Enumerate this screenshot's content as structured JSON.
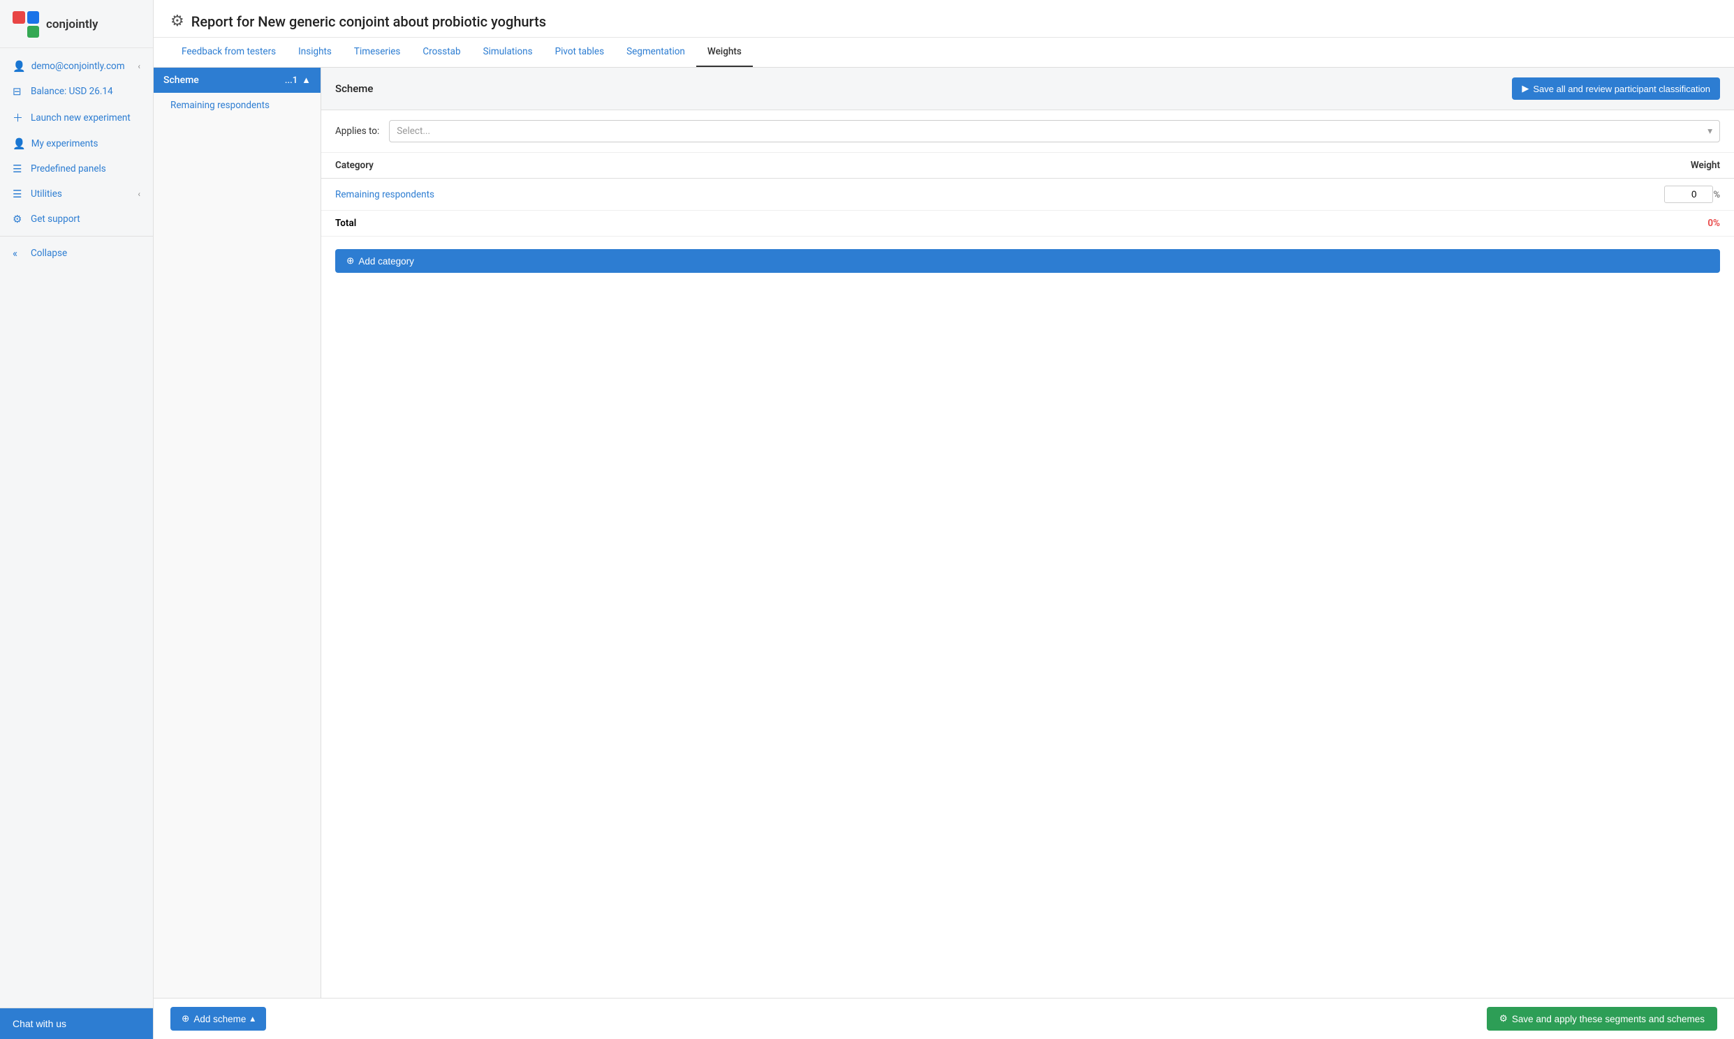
{
  "app": {
    "logo_text": "conjointly"
  },
  "sidebar": {
    "user_email": "demo@conjointly.com",
    "balance": "Balance: USD 26.14",
    "launch": "Launch new experiment",
    "my_experiments": "My experiments",
    "predefined_panels": "Predefined panels",
    "utilities": "Utilities",
    "get_support": "Get support",
    "collapse": "Collapse",
    "chat_label": "Chat with us"
  },
  "header": {
    "icon": "⚙",
    "title": "Report for New generic conjoint about probiotic yoghurts"
  },
  "tabs": [
    {
      "id": "feedback",
      "label": "Feedback from testers",
      "active": false
    },
    {
      "id": "insights",
      "label": "Insights",
      "active": false
    },
    {
      "id": "timeseries",
      "label": "Timeseries",
      "active": false
    },
    {
      "id": "crosstab",
      "label": "Crosstab",
      "active": false
    },
    {
      "id": "simulations",
      "label": "Simulations",
      "active": false
    },
    {
      "id": "pivot",
      "label": "Pivot tables",
      "active": false
    },
    {
      "id": "segmentation",
      "label": "Segmentation",
      "active": false
    },
    {
      "id": "weights",
      "label": "Weights",
      "active": true
    }
  ],
  "scheme_panel": {
    "scheme_label": "Scheme",
    "scheme_number": "...1",
    "sub_item": "Remaining respondents"
  },
  "scheme_detail": {
    "title": "Scheme",
    "save_classify_label": "Save all and review participant classification",
    "applies_label": "Applies to:",
    "applies_placeholder": "Select...",
    "table": {
      "col_category": "Category",
      "col_weight": "Weight",
      "rows": [
        {
          "category": "Remaining respondents",
          "weight": "0",
          "pct": "%"
        }
      ],
      "total_label": "Total",
      "total_value": "0%"
    },
    "add_category_label": "Add category"
  },
  "footer": {
    "add_scheme_label": "Add scheme",
    "save_apply_label": "Save and apply these segments and schemes"
  }
}
